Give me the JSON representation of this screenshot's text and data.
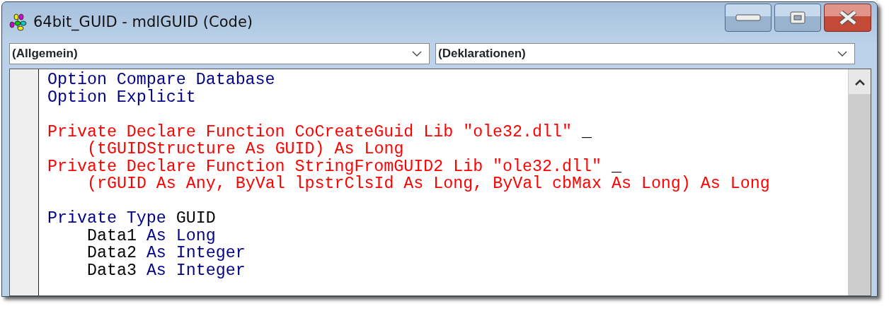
{
  "window": {
    "title": "64bit_GUID - mdlGUID (Code)"
  },
  "dropdowns": [
    {
      "value": "(Allgemein)"
    },
    {
      "value": "(Deklarationen)"
    }
  ],
  "code_lines": [
    {
      "kind": "code",
      "tokens": [
        {
          "kind": "keyword",
          "text": "Option Compare Database"
        }
      ]
    },
    {
      "kind": "code",
      "tokens": [
        {
          "kind": "keyword",
          "text": "Option Explicit"
        }
      ]
    },
    {
      "kind": "blank"
    },
    {
      "kind": "code",
      "tokens": [
        {
          "kind": "error",
          "text": "Private Declare Function CoCreateGuid Lib \"ole32.dll\" "
        },
        {
          "kind": "plain",
          "text": "_"
        }
      ],
      "children": [
        {
          "kind": "code",
          "tokens": [
            {
              "kind": "error",
              "text": "(tGUIDStructure As GUID) As Long"
            }
          ]
        }
      ]
    },
    {
      "kind": "code",
      "tokens": [
        {
          "kind": "error",
          "text": "Private Declare Function StringFromGUID2 Lib \"ole32.dll\" "
        },
        {
          "kind": "plain",
          "text": "_"
        }
      ],
      "children": [
        {
          "kind": "code",
          "tokens": [
            {
              "kind": "error",
              "text": "(rGUID As Any, ByVal lpstrClsId As Long, ByVal cbMax As Long) As Long"
            }
          ]
        }
      ]
    },
    {
      "kind": "blank"
    },
    {
      "kind": "code",
      "tokens": [
        {
          "kind": "keyword",
          "text": "Private Type "
        },
        {
          "kind": "plain",
          "text": "GUID"
        }
      ],
      "children": [
        {
          "kind": "code",
          "tokens": [
            {
              "kind": "plain",
              "text": "Data1 "
            },
            {
              "kind": "keyword",
              "text": "As Long"
            }
          ]
        },
        {
          "kind": "code",
          "tokens": [
            {
              "kind": "plain",
              "text": "Data2 "
            },
            {
              "kind": "keyword",
              "text": "As Integer"
            }
          ]
        },
        {
          "kind": "code",
          "tokens": [
            {
              "kind": "plain",
              "text": "Data3 "
            },
            {
              "kind": "keyword",
              "text": "As Integer"
            }
          ]
        }
      ]
    }
  ]
}
